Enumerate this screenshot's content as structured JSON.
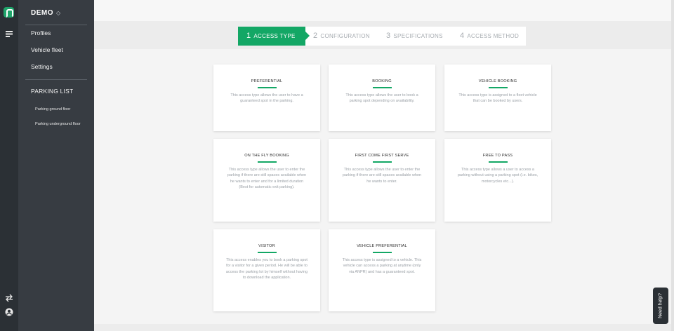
{
  "rail": {
    "icons": [
      "logo-icon",
      "list-icon",
      "swap-icon",
      "user-icon"
    ]
  },
  "sidebar": {
    "org_name": "DEMO",
    "org_chevron": "◇",
    "items": [
      {
        "label": "Profiles"
      },
      {
        "label": "Vehicle fleet"
      },
      {
        "label": "Settings"
      }
    ],
    "parking_heading": "PARKING LIST",
    "parkings": [
      {
        "label": "Parking ground floor"
      },
      {
        "label": "Parking underground floor"
      }
    ]
  },
  "wizard": {
    "steps": [
      {
        "num": "1",
        "label": "ACCESS TYPE",
        "active": true
      },
      {
        "num": "2",
        "label": "CONFIGURATION",
        "active": false
      },
      {
        "num": "3",
        "label": "SPECIFICATIONS",
        "active": false
      },
      {
        "num": "4",
        "label": "ACCESS METHOD",
        "active": false
      }
    ]
  },
  "access_types": [
    {
      "title": "PREFERENTIAL",
      "description": "This access type allows the user to have a guaranteed spot in the parking."
    },
    {
      "title": "BOOKING",
      "description": "This access type allows the user to book a parking spot depending on availability."
    },
    {
      "title": "VEHICLE BOOKING",
      "description": "This access type is assigned to a fleet vehicle that can be booked by users."
    },
    {
      "title": "ON THE FLY BOOKING",
      "description": "This access type allows the user to enter the parking if there are still spaces available when he wants to enter and for a limited duration (Best for automatic exit parking)."
    },
    {
      "title": "FIRST COME FIRST SERVE",
      "description": "This access type allows the user to enter the parking if there are still spaces available when he wants to enter."
    },
    {
      "title": "FREE TO PASS",
      "description": "This access type allows a user to access a parking without using a parking spot (i.e. bikes, motorcycles etc...)."
    },
    {
      "title": "VISITOR",
      "description": "This access enables you to book a parking spot for a visitor for a given period. He will be able to access the parking lot by himself without having to download the application."
    },
    {
      "title": "VEHICLE PREFERENTIAL",
      "description": "This access type is assigned to a vehicle. This vehicle can access a parking at anytime (only via ANPR) and has a guaranteed spot."
    }
  ],
  "help_button": {
    "label": "Need help?"
  },
  "colors": {
    "accent": "#13a765",
    "sidebar": "#373c42",
    "rail": "#2b3035"
  }
}
